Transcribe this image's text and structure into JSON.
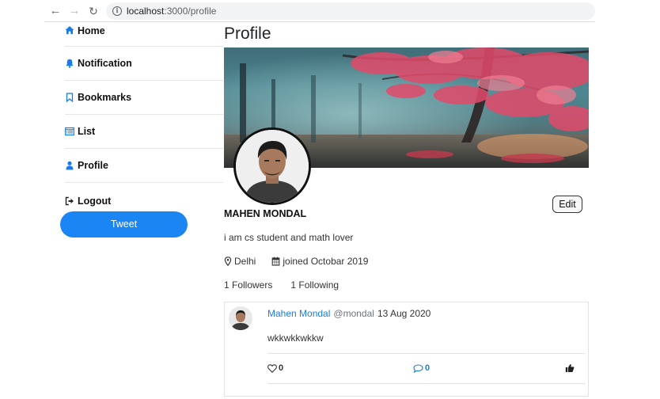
{
  "browser": {
    "url_host": "localhost",
    "url_path": ":3000/profile"
  },
  "sidebar": {
    "items": [
      {
        "label": "Home",
        "icon": "home-icon"
      },
      {
        "label": "Notification",
        "icon": "bell-icon"
      },
      {
        "label": "Bookmarks",
        "icon": "bookmark-icon"
      },
      {
        "label": "List",
        "icon": "list-icon"
      },
      {
        "label": "Profile",
        "icon": "user-icon"
      }
    ],
    "logout_label": "Logout",
    "tweet_button": "Tweet"
  },
  "profile": {
    "title": "Profile",
    "name": "MAHEN MONDAL",
    "bio": "i am cs student and math lover",
    "location": "Delhi",
    "joined": "joined Octobar 2019",
    "followers": "1 Followers",
    "following": "1 Following",
    "edit_label": "Edit"
  },
  "tweet": {
    "author": "Mahen Mondal",
    "handle": "@mondal",
    "date": "13 Aug 2020",
    "text": "wkkwkkwkkw",
    "likes": "0",
    "replies": "0"
  },
  "colors": {
    "accent": "#1b85f4",
    "link": "#1b7be6"
  }
}
